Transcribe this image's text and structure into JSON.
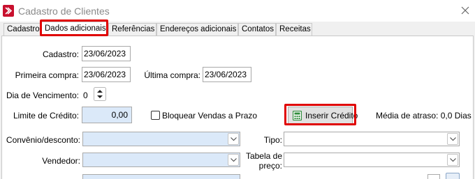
{
  "window": {
    "title": "Cadastro de Clientes",
    "app_icon": "app-logo-icon",
    "close_icon": "close-icon"
  },
  "tabs": [
    {
      "label": "Cadastro",
      "active": false
    },
    {
      "label": "Dados adicionais",
      "active": true
    },
    {
      "label": "Referências",
      "active": false
    },
    {
      "label": "Endereços adicionais",
      "active": false
    },
    {
      "label": "Contatos",
      "active": false
    },
    {
      "label": "Receitas",
      "active": false
    }
  ],
  "form": {
    "cadastro": {
      "label": "Cadastro:",
      "value": "23/06/2023"
    },
    "primeira_compra": {
      "label": "Primeira compra:",
      "value": "23/06/2023"
    },
    "ultima_compra": {
      "label": "Última compra:",
      "value": "23/06/2023"
    },
    "dia_vencimento": {
      "label": "Dia de Vencimento:",
      "value": "0"
    },
    "limite_credito": {
      "label": "Limite de Crédito:",
      "value": "0,00"
    },
    "bloquear_vendas": {
      "label": "Bloquear Vendas a Prazo",
      "checked": false
    },
    "inserir_credito": {
      "label": "Inserir Crédito",
      "icon": "calculator-icon"
    },
    "media_atraso": {
      "text": "Média de atraso: 0,0 Dias"
    },
    "convenio": {
      "label": "Convênio/desconto:",
      "value": ""
    },
    "tipo": {
      "label": "Tipo:",
      "value": ""
    },
    "vendedor": {
      "label": "Vendedor:",
      "value": ""
    },
    "tabela_preco": {
      "label_line1": "Tabela de",
      "label_line2": "preço:",
      "value": ""
    }
  },
  "colors": {
    "highlight": "#e00000",
    "field_blue": "#dbe9f9",
    "icon_green": "#2e8b3a"
  }
}
